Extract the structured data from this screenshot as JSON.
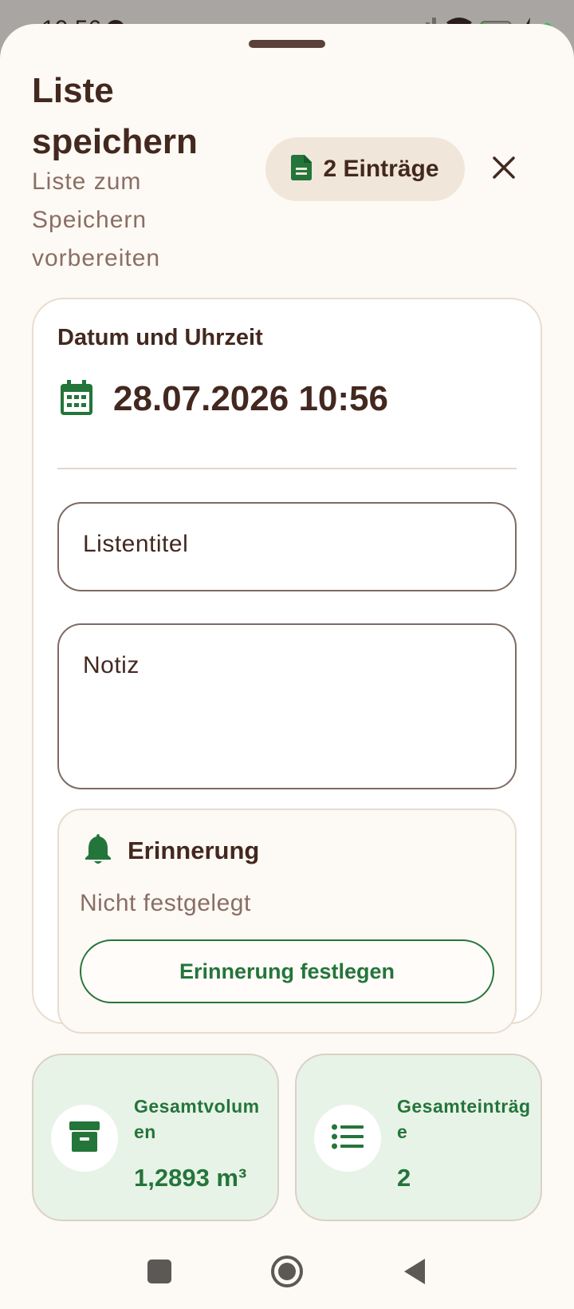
{
  "status_bar": {
    "time": "10:56",
    "battery": "14"
  },
  "header": {
    "title": "Liste speichern",
    "subtitle": "Liste zum Speichern vorbereiten",
    "entry_count_label": "2 Einträge"
  },
  "form": {
    "date_section_label": "Datum und Uhrzeit",
    "date_value": "28.07.2026 10:56",
    "title_placeholder": "Listentitel",
    "note_placeholder": "Notiz",
    "reminder": {
      "title": "Erinnerung",
      "status": "Nicht festgelegt",
      "button_label": "Erinnerung festlegen"
    }
  },
  "stats": {
    "volume_label": "Gesamtvolumen",
    "volume_value": "1,2893 m³",
    "entries_label": "Gesamteinträge",
    "entries_value": "2"
  },
  "icons": {
    "chip": "document-icon",
    "close": "close-icon",
    "date": "calendar-icon",
    "reminder": "bell-icon",
    "volume": "archive-box-icon",
    "entries": "list-icon"
  },
  "colors": {
    "accent_green": "#24753a",
    "text_brown": "#43281f",
    "muted_brown": "#8a6e64",
    "sheet_bg": "#fdf9f4",
    "stat_bg": "#e8f3e8"
  }
}
